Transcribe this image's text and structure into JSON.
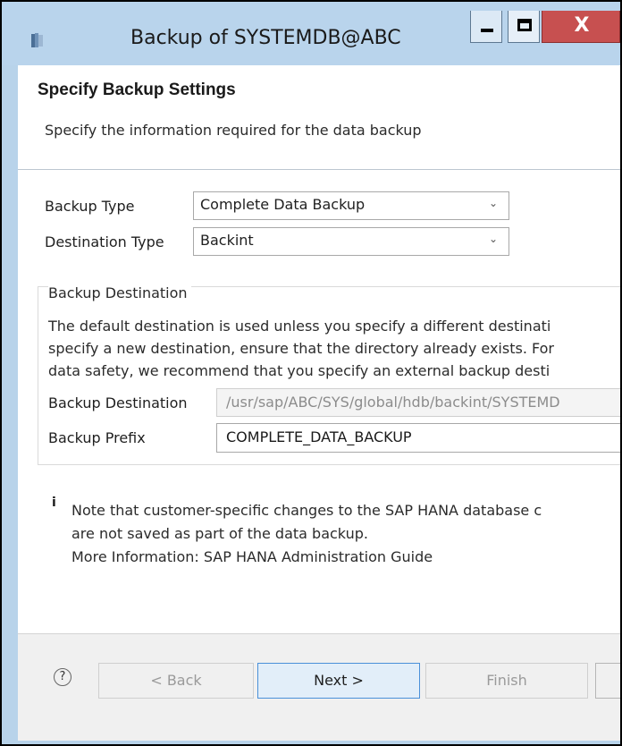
{
  "window": {
    "title": "Backup of SYSTEMDB@ABC",
    "minimize_glyph": "—",
    "maximize_glyph": "☐",
    "close_glyph": "X"
  },
  "header": {
    "title": "Specify Backup Settings",
    "description": "Specify the information required for the data backup"
  },
  "settings": {
    "backup_type_label": "Backup Type",
    "backup_type_value": "Complete Data Backup",
    "destination_type_label": "Destination Type",
    "destination_type_value": "Backint"
  },
  "destination_group": {
    "title": "Backup Destination",
    "description_lines": [
      "The default destination is used unless you specify a different destinati",
      "specify a new destination, ensure that the directory already exists. For",
      "data safety, we recommend that you specify an external backup desti"
    ],
    "destination_label": "Backup Destination",
    "destination_value": "/usr/sap/ABC/SYS/global/hdb/backint/SYSTEMD",
    "prefix_label": "Backup Prefix",
    "prefix_value": "COMPLETE_DATA_BACKUP"
  },
  "note": {
    "icon": "i",
    "lines": [
      "Note that customer-specific changes to the SAP HANA database c",
      "are not saved as part of the data backup.",
      "More Information: SAP HANA Administration Guide"
    ]
  },
  "footer": {
    "help_glyph": "?",
    "back_label": "< Back",
    "next_label": "Next >",
    "finish_label": "Finish"
  },
  "colors": {
    "frame": "#b8d3ea",
    "close_button": "#c75050",
    "footer": "#f0f0f0"
  }
}
